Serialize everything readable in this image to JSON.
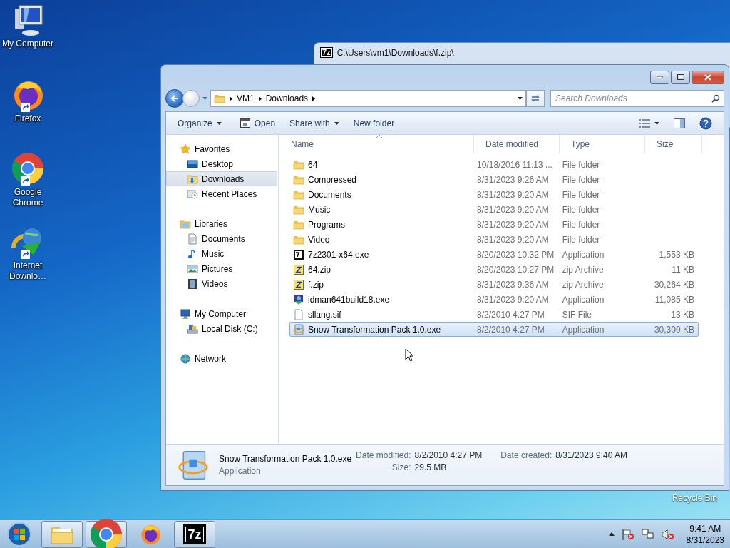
{
  "desktop_icons": [
    {
      "kind": "computer",
      "label": "My Computer",
      "shortcut": false
    },
    {
      "kind": "firefox",
      "label": "Firefox",
      "shortcut": true
    },
    {
      "kind": "chrome",
      "label": "Google Chrome",
      "shortcut": true
    },
    {
      "kind": "idm",
      "label": "Internet Downlo…",
      "shortcut": true
    }
  ],
  "recycle_bin_label": "Recycle Bin",
  "archive_window": {
    "icon_text": "7z",
    "title": "C:\\Users\\vm1\\Downloads\\f.zip\\"
  },
  "explorer": {
    "path": [
      "VM1",
      "Downloads"
    ],
    "search": {
      "placeholder": "Search Downloads"
    },
    "commands": [
      {
        "label": "Organize",
        "kind": "menu"
      },
      {
        "label": "Open",
        "kind": "open"
      },
      {
        "label": "Share with",
        "kind": "menu"
      },
      {
        "label": "New folder",
        "kind": "plain"
      }
    ],
    "nav": [
      {
        "label": "Favorites",
        "kind": "star",
        "selected": false,
        "children": [
          {
            "label": "Desktop",
            "kind": "desktop",
            "selected": false
          },
          {
            "label": "Downloads",
            "kind": "downloads",
            "selected": true
          },
          {
            "label": "Recent Places",
            "kind": "recent",
            "selected": false
          }
        ]
      },
      {
        "label": "Libraries",
        "kind": "library",
        "selected": false,
        "children": [
          {
            "label": "Documents",
            "kind": "document",
            "selected": false
          },
          {
            "label": "Music",
            "kind": "music",
            "selected": false
          },
          {
            "label": "Pictures",
            "kind": "pictures",
            "selected": false
          },
          {
            "label": "Videos",
            "kind": "videos",
            "selected": false
          }
        ]
      },
      {
        "label": "My Computer",
        "kind": "computer",
        "selected": false,
        "children": [
          {
            "label": "Local Disk (C:)",
            "kind": "disk",
            "selected": false
          }
        ]
      },
      {
        "label": "Network",
        "kind": "network",
        "selected": false
      }
    ],
    "columns": [
      {
        "label": "Name",
        "sorted": true
      },
      {
        "label": "Date modified",
        "sorted": false
      },
      {
        "label": "Type",
        "sorted": false
      },
      {
        "label": "Size",
        "sorted": false
      }
    ],
    "files": [
      {
        "name": "64",
        "modified": "10/18/2016 11:13 ...",
        "type": "File folder",
        "kind": "folder",
        "selected": false
      },
      {
        "name": "Compressed",
        "modified": "8/31/2023 9:26 AM",
        "type": "File folder",
        "kind": "folder",
        "selected": false
      },
      {
        "name": "Documents",
        "modified": "8/31/2023 9:20 AM",
        "type": "File folder",
        "kind": "folder",
        "selected": false
      },
      {
        "name": "Music",
        "modified": "8/31/2023 9:20 AM",
        "type": "File folder",
        "kind": "folder",
        "selected": false
      },
      {
        "name": "Programs",
        "modified": "8/31/2023 9:20 AM",
        "type": "File folder",
        "kind": "folder",
        "selected": false
      },
      {
        "name": "Video",
        "modified": "8/31/2023 9:20 AM",
        "type": "File folder",
        "kind": "folder",
        "selected": false
      },
      {
        "name": "7z2301-x64.exe",
        "modified": "8/20/2023 10:32 PM",
        "type": "Application",
        "size": "1,553 KB",
        "kind": "archiver",
        "selected": false
      },
      {
        "name": "64.zip",
        "modified": "8/20/2023 10:27 PM",
        "type": "zip Archive",
        "size": "11 KB",
        "kind": "zip",
        "selected": false
      },
      {
        "name": "f.zip",
        "modified": "8/31/2023 9:36 AM",
        "type": "zip Archive",
        "size": "30,264 KB",
        "kind": "zip",
        "selected": false
      },
      {
        "name": "idman641build18.exe",
        "modified": "8/31/2023 9:20 AM",
        "type": "Application",
        "size": "11,085 KB",
        "kind": "installer",
        "selected": false
      },
      {
        "name": "sllang.sif",
        "modified": "8/2/2010 4:27 PM",
        "type": "SIF File",
        "size": "13 KB",
        "kind": "file",
        "selected": false
      },
      {
        "name": "Snow Transformation Pack 1.0.exe",
        "modified": "8/2/2010 4:27 PM",
        "type": "Application",
        "size": "30,300 KB",
        "kind": "setup",
        "selected": true
      }
    ],
    "details": {
      "name": "Snow Transformation Pack 1.0.exe",
      "type": "Application",
      "field_columns": [
        [
          {
            "label": "Date modified:",
            "value": "8/2/2010 4:27 PM"
          },
          {
            "label": "Size:",
            "value": "29.5 MB"
          }
        ],
        [
          {
            "label": "Date created:",
            "value": "8/31/2023 9:40 AM"
          }
        ]
      ]
    }
  },
  "taskbar": {
    "apps": [
      {
        "kind": "explorer",
        "running": true
      },
      {
        "kind": "chrome",
        "running": true
      },
      {
        "kind": "firefox",
        "running": false
      },
      {
        "kind": "archiver",
        "running": true,
        "text": "7z"
      }
    ],
    "tray": {
      "time": "9:41 AM",
      "date": "8/31/2023"
    }
  }
}
